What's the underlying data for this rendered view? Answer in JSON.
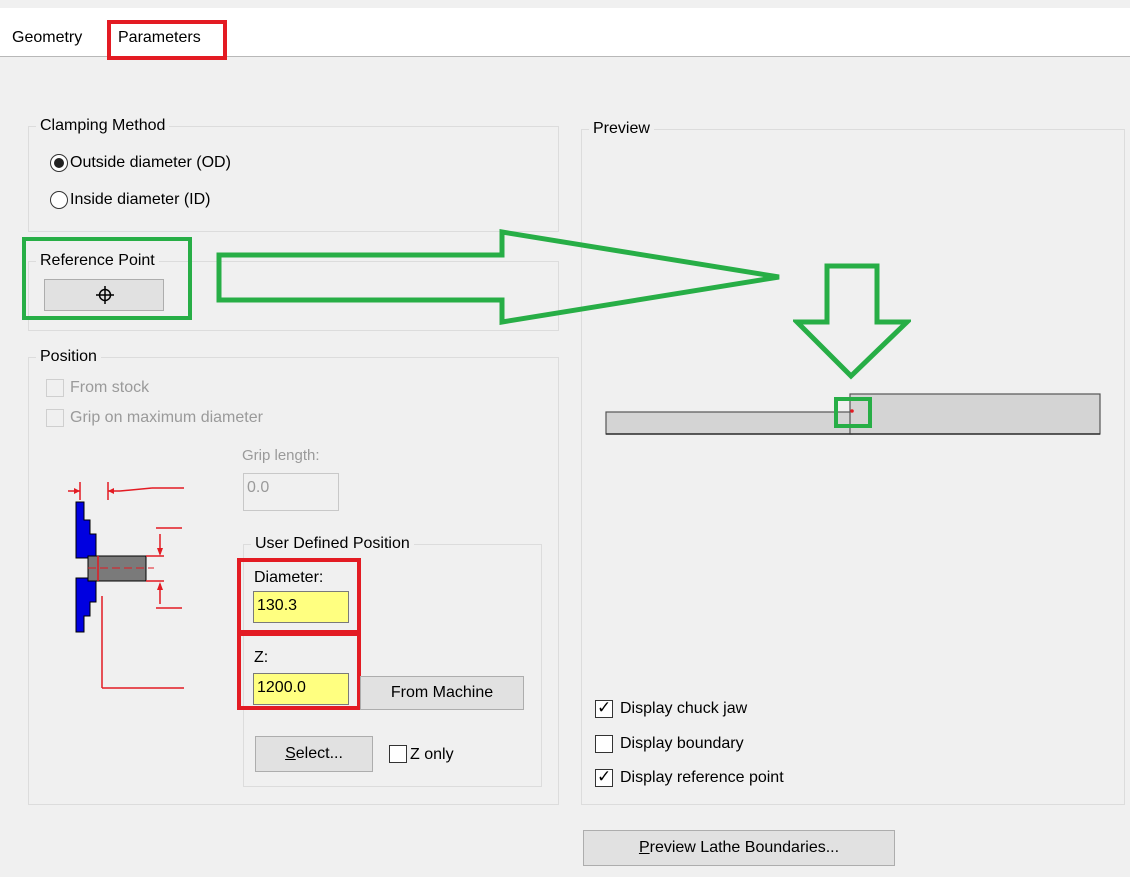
{
  "tabs": [
    {
      "label": "Geometry",
      "active": false
    },
    {
      "label": "Parameters",
      "active": true
    }
  ],
  "clamping": {
    "legend": "Clamping Method",
    "options": [
      "Outside diameter (OD)",
      "Inside diameter (ID)"
    ],
    "selected": "Outside diameter (OD)"
  },
  "reference_point": {
    "legend": "Reference Point",
    "button_icon": "crosshair-icon"
  },
  "position": {
    "legend": "Position",
    "from_stock": {
      "label": "From stock",
      "checked": false,
      "enabled": false
    },
    "grip_max": {
      "label": "Grip on maximum diameter",
      "checked": false,
      "enabled": false
    },
    "grip_length": {
      "label": "Grip length:",
      "value": "0.0",
      "enabled": false
    },
    "user_defined": {
      "legend": "User Defined Position",
      "diameter_label": "Diameter:",
      "diameter_value": "130.3",
      "z_label": "Z:",
      "z_value": "1200.0",
      "from_machine": "From Machine",
      "select_accel": "S",
      "select_rest": "elect...",
      "z_only": {
        "label": "Z only",
        "checked": false
      }
    }
  },
  "preview": {
    "legend": "Preview",
    "display_chuck_jaw": {
      "label": "Display chuck jaw",
      "checked": true
    },
    "display_boundary": {
      "label": "Display boundary",
      "checked": false
    },
    "display_reference_point": {
      "label": "Display reference point",
      "checked": true
    }
  },
  "preview_button": {
    "accel": "P",
    "rest": "review Lathe Boundaries..."
  },
  "colors": {
    "annotation_red": "#e31b23",
    "annotation_green": "#27ae46",
    "input_yellow": "#ffff80",
    "diagram_blue": "#1a1aff"
  }
}
